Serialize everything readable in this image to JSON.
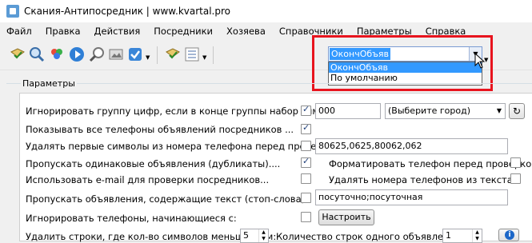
{
  "window": {
    "title": "Скания-Антипосредник | www.kvartal.pro"
  },
  "menu": [
    "Файл",
    "Правка",
    "Действия",
    "Посредники",
    "Хозяева",
    "Справочники",
    "Параметры",
    "Справка"
  ],
  "toolbar": {
    "combo_value": "ОкончОбъяв",
    "dropdown_options": [
      "ОкончОбъяв",
      "По умолчанию"
    ],
    "icons": [
      "envelope-check-icon",
      "search-icon",
      "colors-icon",
      "play-icon",
      "magnifier-icon",
      "image-icon",
      "check-icon",
      "envelope-check-icon",
      "list-icon"
    ]
  },
  "params": {
    "group_label": "Параметры",
    "ignore_digits": {
      "label": "Игнорировать группу цифр, если в конце группы набор символов:",
      "checked": true,
      "value": "000"
    },
    "city_select": {
      "value": "(Выберите город)"
    },
    "show_all_phones": {
      "label": "Показывать все телефоны объявлений посредников ...",
      "checked": true
    },
    "remove_first_symbols": {
      "label": "Удалять первые символы из номера телефона перед проверкой:",
      "checked": false,
      "value": "80625,0625,80062,062"
    },
    "skip_duplicates": {
      "label": "Пропускать одинаковые объявления (дубликаты)....",
      "checked": true
    },
    "format_phone": {
      "label": "Форматировать телефон перед проверкой",
      "checked": false
    },
    "use_email": {
      "label": "Использовать e-mail для проверки посредников...",
      "checked": false
    },
    "remove_phone_numbers": {
      "label": "Удалять номера телефонов из текста",
      "checked": false
    },
    "skip_stopwords": {
      "label": "Пропускать объявления, содержащие текст (стоп-слова):",
      "checked": false,
      "value": "посуточно;посуточная"
    },
    "ignore_phones_starting": {
      "label": "Игнорировать телефоны, начинающиеся с:",
      "checked": false,
      "button": "Настроить"
    },
    "delete_rows": {
      "label": "Удалить строки, где кол-во символов меньше, чем:",
      "value": "5"
    },
    "rows_per_ad": {
      "label": "Количество строк одного объявления:",
      "value": "1"
    }
  },
  "colors": {
    "accent": "#3399ff",
    "highlight_border": "#e8141e"
  }
}
